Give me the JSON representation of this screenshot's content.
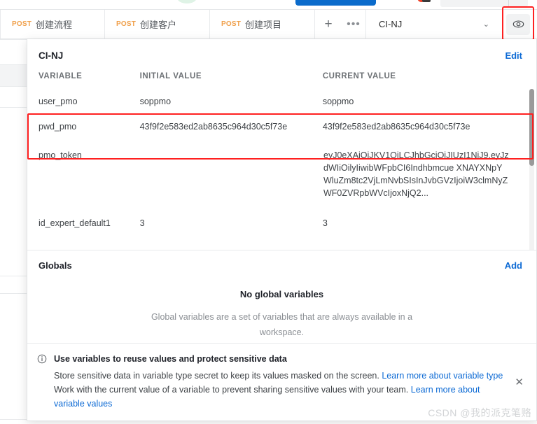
{
  "tabbar": {
    "tabs": [
      {
        "method": "POST",
        "label": "创建流程"
      },
      {
        "method": "POST",
        "label": "创建客户"
      },
      {
        "method": "POST",
        "label": "创建项目"
      }
    ],
    "add_tab_label": "+",
    "more_tabs_label": "•••",
    "environment": {
      "name": "CI-NJ",
      "caret": "⌄",
      "eye_icon": "eye-icon"
    }
  },
  "popover": {
    "title": "CI-NJ",
    "edit_label": "Edit",
    "columns": {
      "variable": "VARIABLE",
      "initial_value": "INITIAL VALUE",
      "current_value": "CURRENT VALUE"
    },
    "rows": [
      {
        "variable": "user_pmo",
        "initial_value": "soppmo",
        "current_value": "soppmo"
      },
      {
        "variable": "pwd_pmo",
        "initial_value": "43f9f2e583ed2ab8635c964d30c5f73e",
        "current_value": "43f9f2e583ed2ab8635c964d30c5f73e"
      },
      {
        "variable": "pmo_token",
        "initial_value": "",
        "current_value": "eyJ0eXAiOiJKV1QiLCJhbGciOiJIUzI1NiJ9.eyJzdWIiOilyIiwibWFpbCI6Indhbmcue XNAYXNpYWluZm8tc2VjLmNvbSIsInJvbGVzIjoiW3clmNyZWF0ZVRpbWVcIjoxNjQ2..."
      },
      {
        "variable": "id_expert_default1",
        "initial_value": "3",
        "current_value": "3"
      }
    ]
  },
  "globals": {
    "title": "Globals",
    "add_label": "Add",
    "empty_title": "No global variables",
    "empty_desc": "Global variables are a set of variables that are always available in a workspace."
  },
  "info": {
    "icon": "info-icon",
    "title": "Use variables to reuse values and protect sensitive data",
    "line1_text": "Store sensitive data in variable type secret to keep its values masked on the screen. ",
    "line1_link": "Learn more about variable type",
    "line2_text": "Work with the current value of a variable to prevent sharing sensitive values with your team. ",
    "line2_link": "Learn more about variable values",
    "close_label": "✕"
  },
  "watermark": "CSDN @我的派克笔赂",
  "colors": {
    "link": "#0b69d4",
    "method_post": "#f0a04b",
    "highlight": "#ff2020"
  }
}
